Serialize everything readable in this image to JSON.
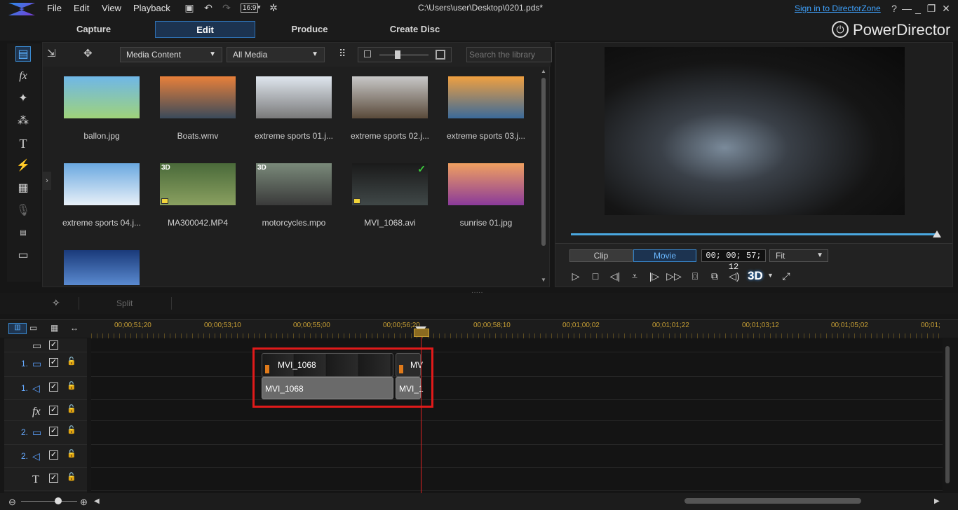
{
  "window": {
    "title": "C:\\Users\\user\\Desktop\\0201.pds*",
    "signin": "Sign in to DirectorZone",
    "brand": "PowerDirector"
  },
  "menu": [
    "File",
    "Edit",
    "View",
    "Playback"
  ],
  "aspect": "16:9",
  "modes": [
    "Capture",
    "Edit",
    "Produce",
    "Create Disc"
  ],
  "active_mode": "Edit",
  "library": {
    "content_dropdown": "Media Content",
    "filter_dropdown": "All Media",
    "search_placeholder": "Search the library",
    "items": [
      {
        "name": "ballon.jpg",
        "colors": [
          "#6fb7e8",
          "#9fd37a"
        ],
        "badge3d": false,
        "check": false
      },
      {
        "name": "Boats.wmv",
        "colors": [
          "#e8803a",
          "#3a4a5a"
        ],
        "badge3d": false,
        "check": false
      },
      {
        "name": "extreme sports 01.j...",
        "colors": [
          "#dfe6ee",
          "#7a7a7a"
        ],
        "badge3d": false,
        "check": false
      },
      {
        "name": "extreme sports 02.j...",
        "colors": [
          "#c8c8c8",
          "#5a4a3a"
        ],
        "badge3d": false,
        "check": false
      },
      {
        "name": "extreme sports 03.j...",
        "colors": [
          "#f0a040",
          "#3a6a9a"
        ],
        "badge3d": false,
        "check": false
      },
      {
        "name": "extreme sports 04.j...",
        "colors": [
          "#6aa8e0",
          "#e8f0f8"
        ],
        "badge3d": false,
        "check": false
      },
      {
        "name": "MA300042.MP4",
        "colors": [
          "#4a6a3a",
          "#8aa060"
        ],
        "badge3d": true,
        "check": false
      },
      {
        "name": "motorcycles.mpo",
        "colors": [
          "#7a8a7a",
          "#3a3a3a"
        ],
        "badge3d": true,
        "check": false
      },
      {
        "name": "MVI_1068.avi",
        "colors": [
          "#1a1a1a",
          "#404848"
        ],
        "badge3d": false,
        "check": true
      },
      {
        "name": "sunrise 01.jpg",
        "colors": [
          "#f0a060",
          "#8a3a9a"
        ],
        "badge3d": false,
        "check": false
      },
      {
        "name": "",
        "colors": [
          "#1a3a7a",
          "#5a8ad0"
        ],
        "badge3d": false,
        "check": false
      }
    ]
  },
  "preview": {
    "clip_label": "Clip",
    "movie_label": "Movie",
    "timecode": "00; 00; 57; 12",
    "fit": "Fit",
    "badge_3d": "3D"
  },
  "split": {
    "label": "Split"
  },
  "timeline": {
    "ticks": [
      "00;00;51;20",
      "00;00;53;10",
      "00;00;55;00",
      "00;00;56;20",
      "00;00;58;10",
      "00;01;00;02",
      "00;01;01;22",
      "00;01;03;12",
      "00;01;05;02",
      "00;01;"
    ],
    "tracks": [
      {
        "num": "",
        "icon": "fx-box-icon",
        "glyph": "▭"
      },
      {
        "num": "1.",
        "icon": "video-track-icon",
        "glyph": "▭"
      },
      {
        "num": "1.",
        "icon": "audio-track-icon",
        "glyph": "◁"
      },
      {
        "num": "",
        "icon": "fx-track-icon",
        "glyph": "fx"
      },
      {
        "num": "2.",
        "icon": "video-track-icon",
        "glyph": "▭"
      },
      {
        "num": "2.",
        "icon": "audio-track-icon",
        "glyph": "◁"
      },
      {
        "num": "",
        "icon": "title-track-icon",
        "glyph": "T"
      }
    ],
    "clip_video_1": "MVI_1068",
    "clip_audio_1": "MVI_1068",
    "clip_video_2": "MV",
    "clip_audio_2": "MVI_1"
  }
}
